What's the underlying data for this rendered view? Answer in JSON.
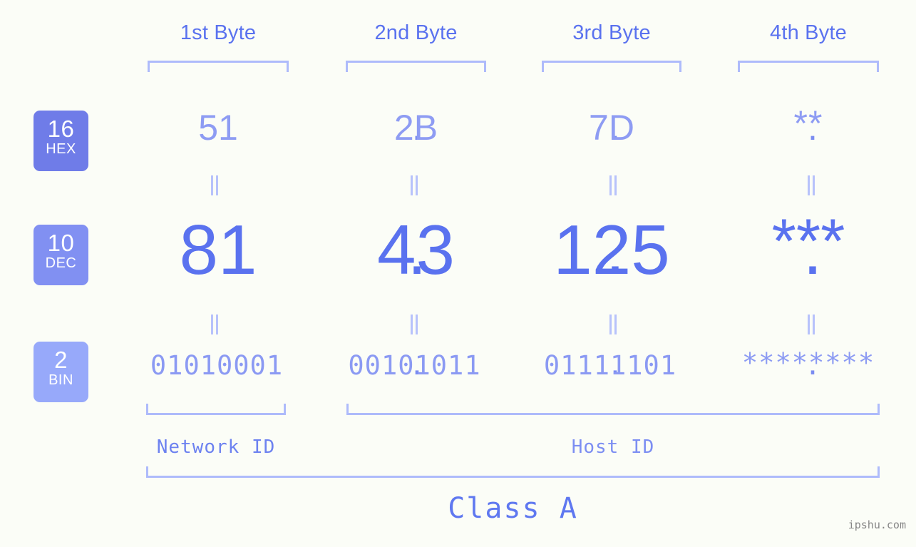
{
  "meta": {
    "background": "#fbfdf7",
    "accent": "#5a72ef",
    "accent_light": "#8e9cf3",
    "bracket": "#aebbfb",
    "watermark": "ipshu.com"
  },
  "byte_headers": [
    {
      "label": "1st Byte"
    },
    {
      "label": "2nd Byte"
    },
    {
      "label": "3rd Byte"
    },
    {
      "label": "4th Byte"
    }
  ],
  "bases": [
    {
      "key": "hex",
      "number": "16",
      "name": "HEX",
      "color": "#6f7ce8"
    },
    {
      "key": "dec",
      "number": "10",
      "name": "DEC",
      "color": "#8190f2"
    },
    {
      "key": "bin",
      "number": "2",
      "name": "BIN",
      "color": "#97a9fa"
    }
  ],
  "separator": ".",
  "equals": "=",
  "rows": {
    "hex": {
      "b1": "51",
      "b2": "2B",
      "b3": "7D",
      "b4": "**"
    },
    "dec": {
      "b1": "81",
      "b2": "43",
      "b3": "125",
      "b4": "***"
    },
    "bin": {
      "b1": "01010001",
      "b2": "00101011",
      "b3": "01111101",
      "b4": "********"
    }
  },
  "footer": {
    "network_id": "Network ID",
    "host_id": "Host ID",
    "class": "Class A"
  }
}
